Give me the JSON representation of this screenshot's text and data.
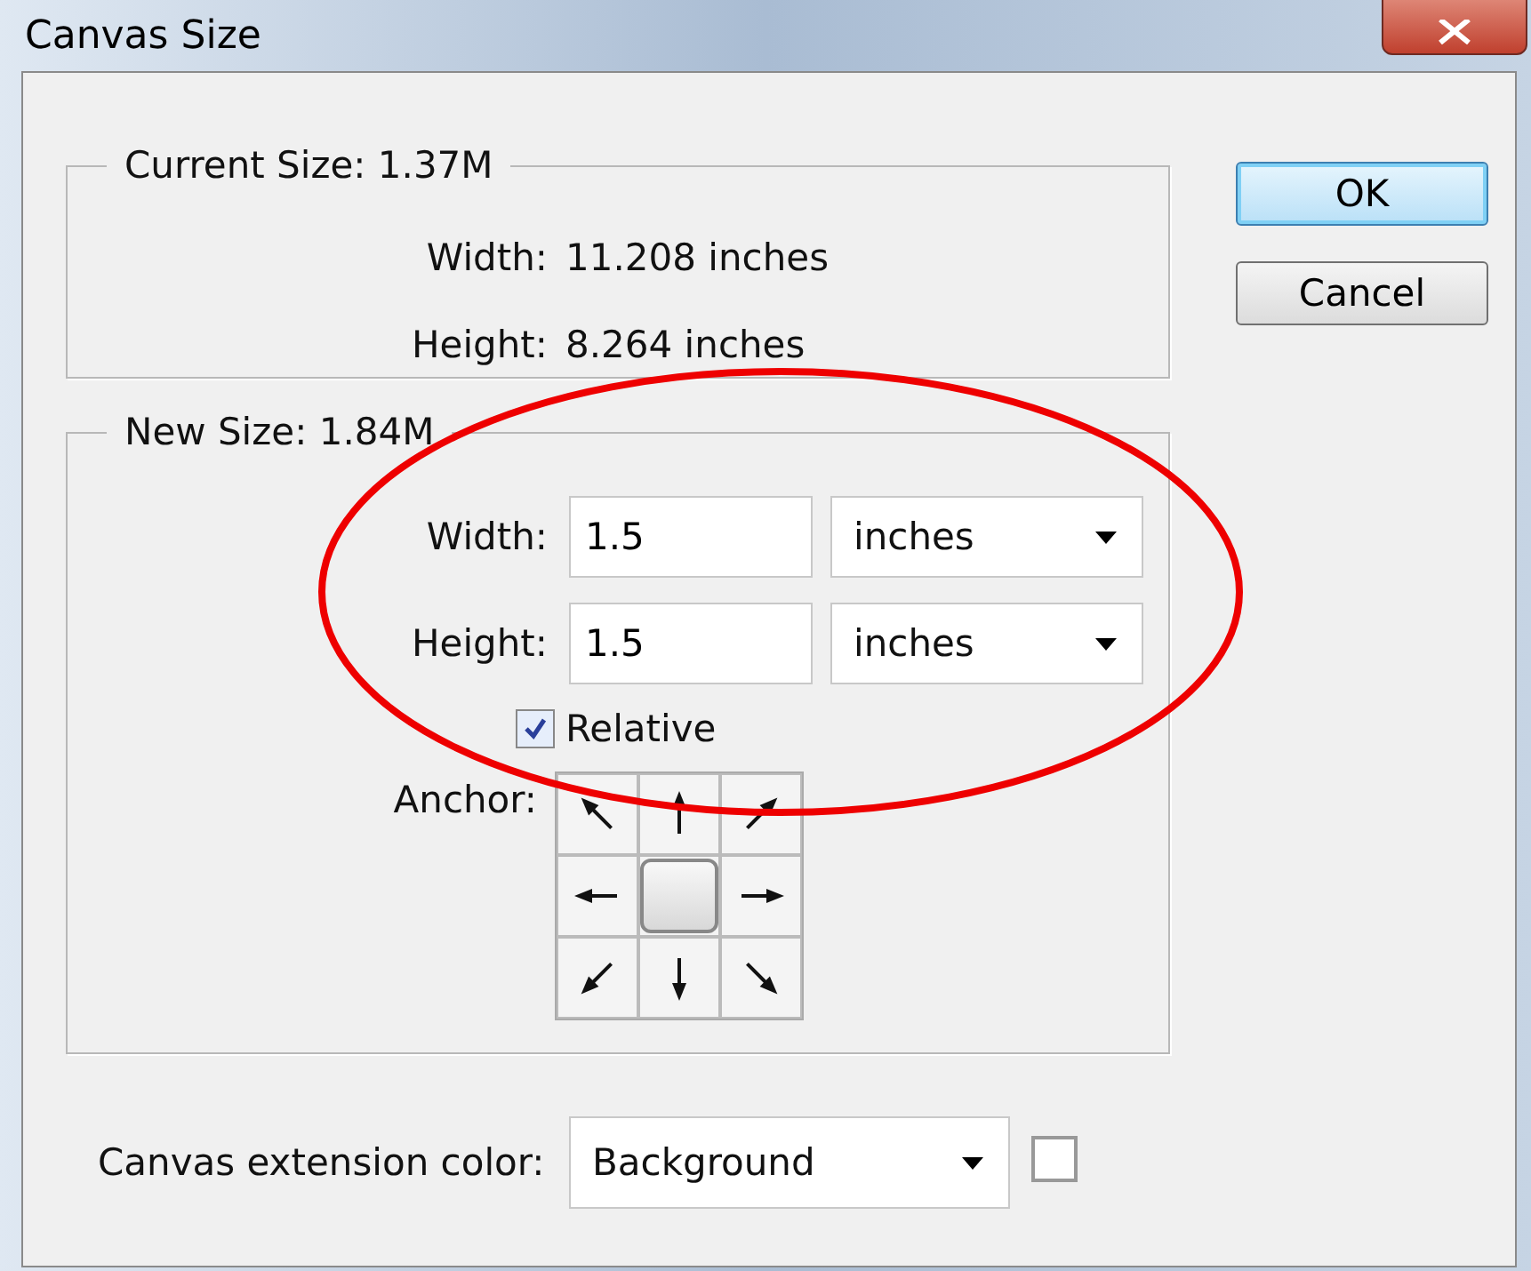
{
  "window": {
    "title": "Canvas Size"
  },
  "current_size": {
    "legend": "Current Size: 1.37M",
    "rows": [
      {
        "label": "Width:",
        "value": "11.208 inches"
      },
      {
        "label": "Height:",
        "value": "8.264 inches"
      }
    ]
  },
  "new_size": {
    "legend": "New Size: 1.84M",
    "fields": [
      {
        "label": "Width:",
        "value": "1.5",
        "unit": "inches"
      },
      {
        "label": "Height:",
        "value": "1.5",
        "unit": "inches"
      }
    ],
    "relative": {
      "label": "Relative",
      "checked": true
    },
    "anchor": {
      "label": "Anchor:",
      "cells": [
        {
          "selected": false
        },
        {
          "selected": false
        },
        {
          "selected": false
        },
        {
          "selected": false
        },
        {
          "selected": true
        },
        {
          "selected": false
        },
        {
          "selected": false
        },
        {
          "selected": false
        },
        {
          "selected": false
        }
      ]
    }
  },
  "extension": {
    "label": "Canvas extension color:",
    "value": "Background"
  },
  "buttons": [
    {
      "label": "OK",
      "default": true
    },
    {
      "label": "Cancel",
      "default": false
    }
  ]
}
